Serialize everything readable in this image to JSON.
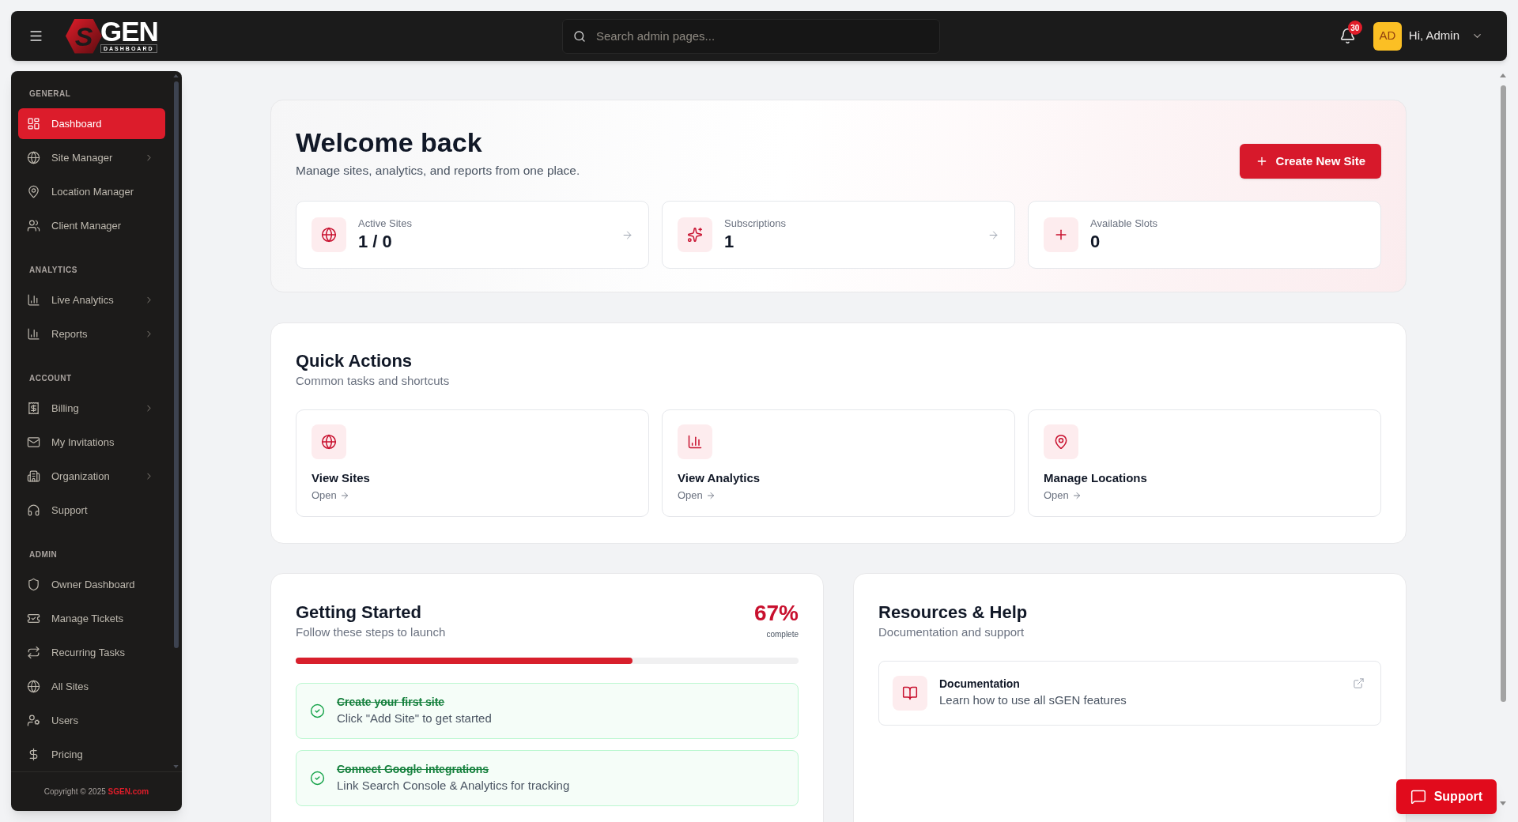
{
  "top_bar": {
    "logo": {
      "mark": "S",
      "name": "GEN",
      "tagline": "DASHBOARD"
    },
    "search": {
      "placeholder": "Search admin pages..."
    },
    "notifications": {
      "count": "30"
    },
    "user": {
      "initials": "AD",
      "greeting": "Hi, Admin"
    }
  },
  "sidebar": {
    "sections": [
      {
        "title": "GENERAL",
        "items": [
          {
            "label": "Dashboard",
            "selected": true,
            "has_submenu": false
          },
          {
            "label": "Site Manager",
            "selected": false,
            "has_submenu": true
          },
          {
            "label": "Location Manager",
            "selected": false,
            "has_submenu": false
          },
          {
            "label": "Client Manager",
            "selected": false,
            "has_submenu": false
          }
        ]
      },
      {
        "title": "ANALYTICS",
        "items": [
          {
            "label": "Live Analytics",
            "selected": false,
            "has_submenu": true
          },
          {
            "label": "Reports",
            "selected": false,
            "has_submenu": true
          }
        ]
      },
      {
        "title": "ACCOUNT",
        "items": [
          {
            "label": "Billing",
            "selected": false,
            "has_submenu": true
          },
          {
            "label": "My Invitations",
            "selected": false,
            "has_submenu": false
          },
          {
            "label": "Organization",
            "selected": false,
            "has_submenu": true
          },
          {
            "label": "Support",
            "selected": false,
            "has_submenu": false
          }
        ]
      },
      {
        "title": "ADMIN",
        "items": [
          {
            "label": "Owner Dashboard",
            "selected": false,
            "has_submenu": false
          },
          {
            "label": "Manage Tickets",
            "selected": false,
            "has_submenu": false
          },
          {
            "label": "Recurring Tasks",
            "selected": false,
            "has_submenu": false
          },
          {
            "label": "All Sites",
            "selected": false,
            "has_submenu": false
          },
          {
            "label": "Users",
            "selected": false,
            "has_submenu": false
          },
          {
            "label": "Pricing",
            "selected": false,
            "has_submenu": false
          }
        ]
      }
    ],
    "footer": {
      "text": "Copyright © 2025",
      "link": "SGEN.com"
    }
  },
  "welcome": {
    "title": "Welcome back",
    "subtitle": "Manage sites, analytics, and reports from one place.",
    "button": "Create New Site",
    "stats": [
      {
        "label": "Active Sites",
        "value": "1 / 0",
        "linked": true
      },
      {
        "label": "Subscriptions",
        "value": "1",
        "linked": true
      },
      {
        "label": "Available Slots",
        "value": "0",
        "linked": false
      }
    ]
  },
  "quick_actions": {
    "title": "Quick Actions",
    "subtitle": "Common tasks and shortcuts",
    "actions": [
      {
        "title": "View Sites",
        "link": "Open"
      },
      {
        "title": "View Analytics",
        "link": "Open"
      },
      {
        "title": "Manage Locations",
        "link": "Open"
      }
    ]
  },
  "getting_started": {
    "title": "Getting Started",
    "subtitle": "Follow these steps to launch",
    "percent": "67%",
    "percent_caption": "complete",
    "progress": {
      "level": 0.67
    },
    "steps": [
      {
        "title": "Create your first site",
        "description": "Click \"Add Site\" to get started",
        "completed": true
      },
      {
        "title": "Connect Google integrations",
        "description": "Link Search Console & Analytics for tracking",
        "completed": true
      }
    ]
  },
  "resources": {
    "title": "Resources & Help",
    "subtitle": "Documentation and support",
    "items": [
      {
        "title": "Documentation",
        "description": "Learn how to use all sGEN features"
      }
    ]
  },
  "support_button": {
    "label": "Support"
  }
}
